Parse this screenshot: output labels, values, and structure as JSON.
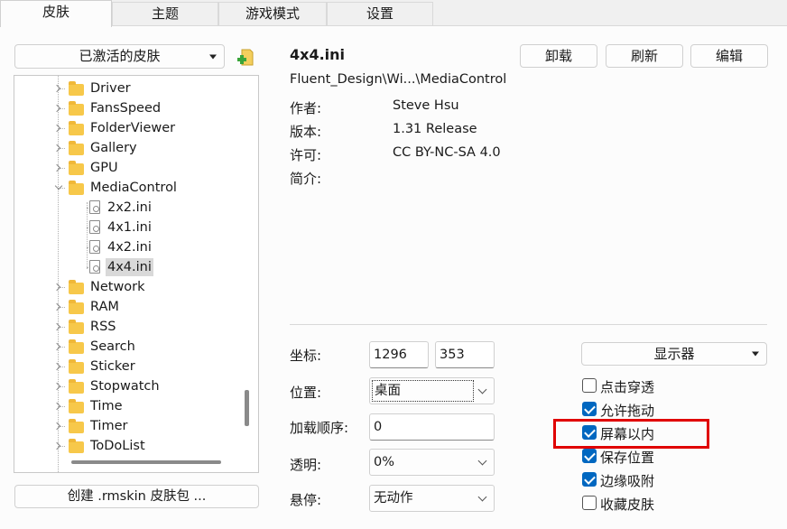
{
  "tabs": [
    "皮肤",
    "主题",
    "游戏模式",
    "设置"
  ],
  "active_skins_dropdown": "已激活的皮肤",
  "tree_items": [
    {
      "label": "Driver",
      "type": "folder"
    },
    {
      "label": "FansSpeed",
      "type": "folder"
    },
    {
      "label": "FolderViewer",
      "type": "folder"
    },
    {
      "label": "Gallery",
      "type": "folder"
    },
    {
      "label": "GPU",
      "type": "folder"
    },
    {
      "label": "MediaControl",
      "type": "folder-open"
    },
    {
      "label": "2x2.ini",
      "type": "file"
    },
    {
      "label": "4x1.ini",
      "type": "file"
    },
    {
      "label": "4x2.ini",
      "type": "file"
    },
    {
      "label": "4x4.ini",
      "type": "file-selected"
    },
    {
      "label": "Network",
      "type": "folder"
    },
    {
      "label": "RAM",
      "type": "folder"
    },
    {
      "label": "RSS",
      "type": "folder"
    },
    {
      "label": "Search",
      "type": "folder"
    },
    {
      "label": "Sticker",
      "type": "folder"
    },
    {
      "label": "Stopwatch",
      "type": "folder"
    },
    {
      "label": "Time",
      "type": "folder"
    },
    {
      "label": "Timer",
      "type": "folder"
    },
    {
      "label": "ToDoList",
      "type": "folder"
    }
  ],
  "create_button": "创建 .rmskin 皮肤包 ...",
  "skin": {
    "name": "4x4.ini",
    "path": "Fluent_Design\\Wi...\\MediaControl",
    "author_label": "作者:",
    "author": "Steve Hsu",
    "version_label": "版本:",
    "version": "1.31 Release",
    "license_label": "许可:",
    "license": "CC BY-NC-SA 4.0",
    "info_label": "简介:"
  },
  "actions": {
    "unload": "卸载",
    "refresh": "刷新",
    "edit": "编辑"
  },
  "settings": {
    "coords_label": "坐标:",
    "x": "1296",
    "y": "353",
    "position_label": "位置:",
    "position": "桌面",
    "load_order_label": "加载顺序:",
    "load_order": "0",
    "transparency_label": "透明:",
    "transparency": "0%",
    "hover_label": "悬停:",
    "hover": "无动作",
    "display_dropdown": "显示器"
  },
  "checkboxes": [
    {
      "label": "点击穿透",
      "checked": false
    },
    {
      "label": "允许拖动",
      "checked": true
    },
    {
      "label": "屏幕以内",
      "checked": true,
      "highlighted": true
    },
    {
      "label": "保存位置",
      "checked": true
    },
    {
      "label": "边缘吸附",
      "checked": true
    },
    {
      "label": "收藏皮肤",
      "checked": false
    }
  ],
  "highlight_color": "#e00000",
  "accent_color": "#0067c0"
}
